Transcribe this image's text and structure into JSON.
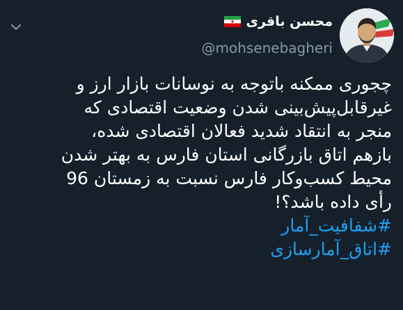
{
  "header": {
    "display_name": "محسن باقری",
    "handle": "@mohsenebagheri",
    "flag_icon": "iran-flag-icon",
    "menu_icon": "chevron-down-icon"
  },
  "tweet": {
    "lines": [
      "چجوری ممکنه باتوجه به نوسانات بازار ارز و",
      "غیرقابل‌پیش‌بینی شدن وضعیت اقتصادی که",
      "منجر به انتقاد شدید فعالان اقتصادی شده،",
      "بازهم اتاق بازرگانی استان فارس به بهتر شدن",
      "محیط کسب‌وکار فارس نسبت به زمستان 96",
      "رأی داده باشد؟!"
    ],
    "hashtags": [
      "#شفافیت_آمار",
      "#اتاق_آمارسازی"
    ]
  },
  "colors": {
    "background": "#15202b",
    "text": "#ffffff",
    "muted": "#8899a6",
    "link": "#1da1f2"
  }
}
